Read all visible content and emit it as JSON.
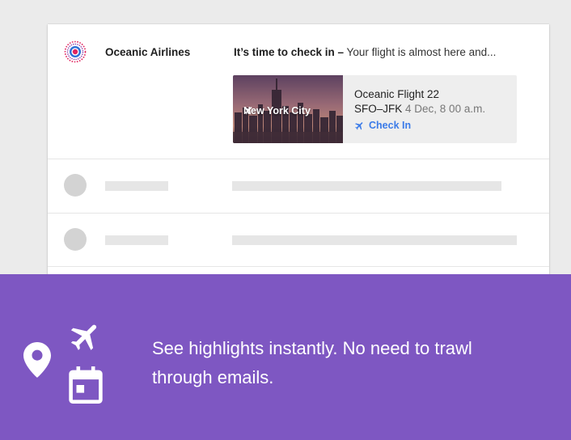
{
  "email": {
    "sender": "Oceanic Airlines",
    "subject": "It’s time to check in –",
    "preview": " Your flight is almost here and..."
  },
  "flight": {
    "image_label": "New York City",
    "title": "Oceanic Flight 22",
    "route": "SFO–JFK",
    "date": "4 Dec, 8 00 a.m.",
    "action": "Check In"
  },
  "banner": {
    "text": "See highlights instantly. No need to trawl through emails."
  },
  "colors": {
    "banner_bg": "#7e57c2",
    "link": "#3b7be8",
    "placeholder": "#e6e6e6"
  },
  "icons": [
    "airline-logo-icon",
    "airplane-icon",
    "location-pin-icon",
    "calendar-icon"
  ]
}
